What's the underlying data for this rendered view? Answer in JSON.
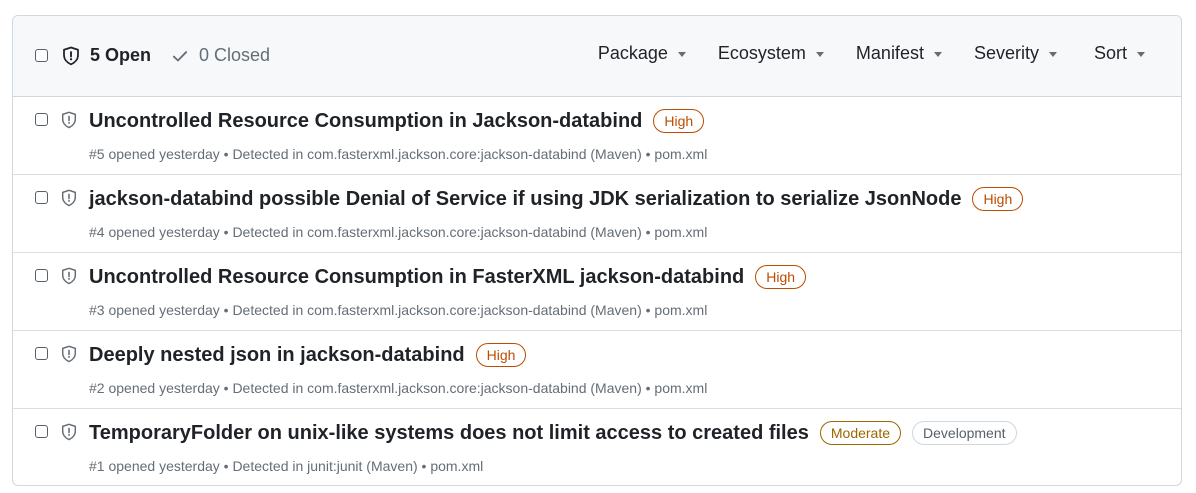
{
  "header": {
    "open_label": "5 Open",
    "closed_label": "0 Closed",
    "filters": [
      {
        "label": "Package"
      },
      {
        "label": "Ecosystem"
      },
      {
        "label": "Manifest"
      },
      {
        "label": "Severity"
      },
      {
        "label": "Sort"
      }
    ]
  },
  "alerts": [
    {
      "title": "Uncontrolled Resource Consumption in Jackson-databind",
      "severity": "High",
      "tag": "",
      "meta": "#5 opened yesterday • Detected in com.fasterxml.jackson.core:jackson-databind (Maven) • pom.xml"
    },
    {
      "title": "jackson-databind possible Denial of Service if using JDK serialization to serialize JsonNode",
      "severity": "High",
      "tag": "",
      "meta": "#4 opened yesterday • Detected in com.fasterxml.jackson.core:jackson-databind (Maven) • pom.xml"
    },
    {
      "title": "Uncontrolled Resource Consumption in FasterXML jackson-databind",
      "severity": "High",
      "tag": "",
      "meta": "#3 opened yesterday • Detected in com.fasterxml.jackson.core:jackson-databind (Maven) • pom.xml"
    },
    {
      "title": "Deeply nested json in jackson-databind",
      "severity": "High",
      "tag": "",
      "meta": "#2 opened yesterday • Detected in com.fasterxml.jackson.core:jackson-databind (Maven) • pom.xml"
    },
    {
      "title": "TemporaryFolder on unix-like systems does not limit access to created files",
      "severity": "Moderate",
      "tag": "Development",
      "meta": "#1 opened yesterday • Detected in junit:junit (Maven) • pom.xml"
    }
  ],
  "colors": {
    "high": "#bc4c00",
    "moderate": "#9a6700",
    "muted": "#656d76",
    "header_bg": "#f6f8fa"
  }
}
